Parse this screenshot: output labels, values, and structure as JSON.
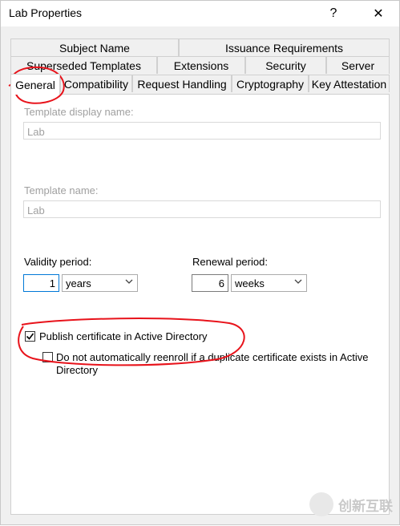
{
  "window": {
    "title": "Lab Properties",
    "help_glyph": "?",
    "close_glyph": "✕"
  },
  "tabs": {
    "row1": [
      "Subject Name",
      "Issuance Requirements"
    ],
    "row2": [
      "Superseded Templates",
      "Extensions",
      "Security",
      "Server"
    ],
    "row3": [
      "General",
      "Compatibility",
      "Request Handling",
      "Cryptography",
      "Key Attestation"
    ]
  },
  "general": {
    "display_name_label": "Template display name:",
    "display_name_value": "Lab",
    "template_name_label": "Template name:",
    "template_name_value": "Lab",
    "validity_label": "Validity period:",
    "validity_value": "1",
    "validity_unit": "years",
    "renewal_label": "Renewal period:",
    "renewal_value": "6",
    "renewal_unit": "weeks",
    "publish_label": "Publish certificate in Active Directory",
    "publish_checked": true,
    "reenroll_label_line1": "Do not automatically reenroll if a duplicate certificate exists in Active",
    "reenroll_label_line2": "Directory",
    "reenroll_checked": false
  },
  "watermark": {
    "text": "创新互联"
  },
  "colors": {
    "accent": "#0078d7",
    "annotation_red": "#e8131b"
  }
}
